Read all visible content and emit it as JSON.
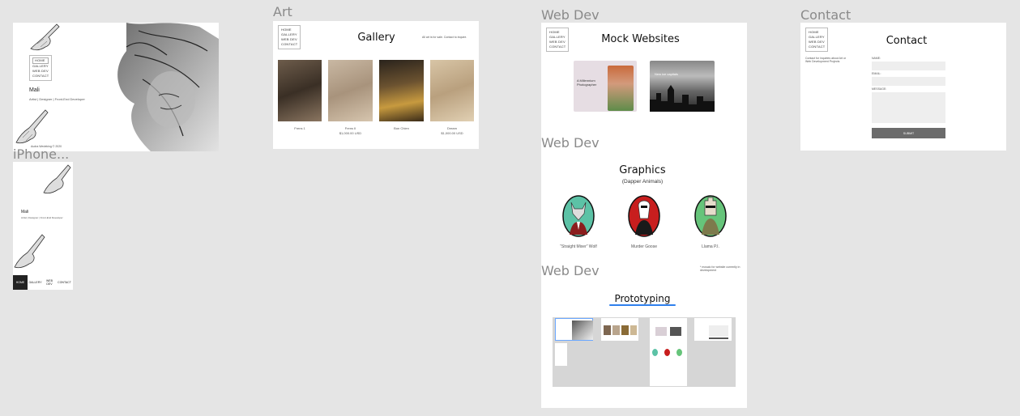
{
  "frames": {
    "home": {
      "nav": [
        "HOME",
        "GALLERY",
        "WEB DEV",
        "CONTACT"
      ],
      "name": "Mali",
      "subtitle": "Artist | Designer | Front-End Developer",
      "footer": "Audra Wedeking © 2020"
    },
    "iphone": {
      "label": "iPhone...",
      "name": "Mali",
      "subtitle": "Artist | Designer | Front-End Developer",
      "tabs": [
        "HOME",
        "GALLERY",
        "WEB DEV",
        "CONTACT"
      ]
    },
    "art": {
      "label": "Art",
      "nav": [
        "HOME",
        "GALLERY",
        "WEB DEV",
        "CONTACT"
      ],
      "title": "Gallery",
      "note": "All art is for sale. Contact to inquire.",
      "artworks": [
        {
          "title": "Frens 1",
          "price": ""
        },
        {
          "title": "Frens II",
          "price": "$1,000.00 USD"
        },
        {
          "title": "Bon Chien",
          "price": ""
        },
        {
          "title": "Dream",
          "price": "$1,000.00 USD"
        }
      ]
    },
    "webdev": {
      "label": "Web Dev",
      "nav": [
        "HOME",
        "GALLERY",
        "WEB DEV",
        "CONTACT"
      ],
      "title": "Mock Websites",
      "mock1_text": "A Millennium Photographer",
      "mock2_text": "New ice capitals"
    },
    "graphics": {
      "label": "Web Dev",
      "title": "Graphics",
      "subtitle": "(Dapper Animals)",
      "animals": [
        "“Straight Mixer” Wolf",
        "Murder Goose",
        "Llama P.I."
      ]
    },
    "prototyping": {
      "label": "Web Dev",
      "note": "* mosaic for website currently in development",
      "title": "Prototyping"
    },
    "contact": {
      "label": "Contact",
      "nav": [
        "HOME",
        "GALLERY",
        "WEB DEV",
        "CONTACT"
      ],
      "title": "Contact",
      "intro": "Contact for inquiries about Art or Web Development Projects",
      "fields": [
        "NAME:",
        "EMAIL:",
        "MESSAGE:"
      ],
      "submit": "SUBMIT"
    }
  },
  "colors": {
    "canvas": "#e5e5e5",
    "frame_label": "#8a8a8a",
    "submit": "#6b6b6b",
    "wolf_bg": "#5cc2a6",
    "goose_bg": "#c81e1e",
    "llama_bg": "#66c47a",
    "link": "#2f80ed"
  }
}
